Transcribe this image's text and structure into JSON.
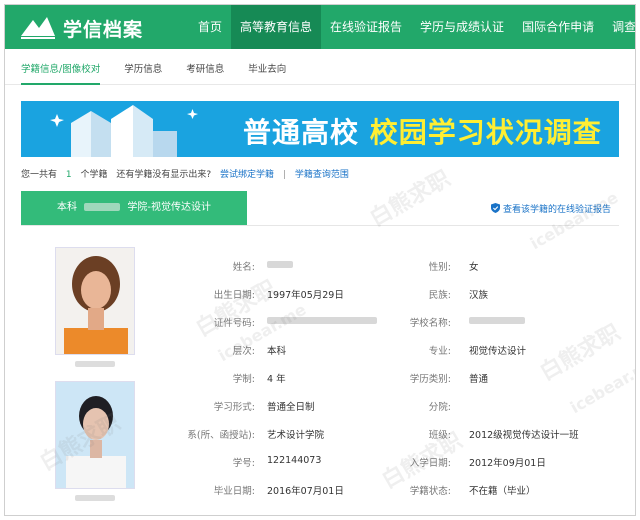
{
  "brand": {
    "title": "学信档案",
    "color": "#22a86a"
  },
  "nav": {
    "items": [
      "首页",
      "高等教育信息",
      "在线验证报告",
      "学历与成绩认证",
      "国际合作申请",
      "调查/投票"
    ],
    "active_index": 1
  },
  "subnav": {
    "items": [
      "学籍信息/图像校对",
      "学历信息",
      "考研信息",
      "毕业去向"
    ],
    "active_index": 0
  },
  "banner": {
    "part1": "普通高校",
    "part2": "校园学习状况调查"
  },
  "infoline": {
    "prefix": "您一共有",
    "count": "1",
    "suffix": "个学籍",
    "question": "还有学籍没有显示出来?",
    "link1": "尝试绑定学籍",
    "separator": "|",
    "link2": "学籍查询范围"
  },
  "record_tab": {
    "level": "本科",
    "school_suffix": "学院-视觉传达设计"
  },
  "verify_link": "查看该学籍的在线验证报告",
  "details": {
    "name_label": "姓名:",
    "gender_label": "性别:",
    "gender": "女",
    "birth_label": "出生日期:",
    "birth": "1997年05月29日",
    "ethnicity_label": "民族:",
    "ethnicity": "汉族",
    "id_label": "证件号码:",
    "school_label": "学校名称:",
    "level_label": "层次:",
    "level": "本科",
    "major_label": "专业:",
    "major": "视觉传达设计",
    "duration_label": "学制:",
    "duration": "4 年",
    "category_label": "学历类别:",
    "category": "普通",
    "form_label": "学习形式:",
    "form": "普通全日制",
    "branch_label": "分院:",
    "dept_label": "系(所、函授站):",
    "dept": "艺术设计学院",
    "class_label": "班级:",
    "class": "2012级视觉传达设计一班",
    "student_no_label": "学号:",
    "student_no": "122144073",
    "entry_label": "入学日期:",
    "entry": "2012年09月01日",
    "grad_label": "毕业日期:",
    "grad": "2016年07月01日",
    "status_label": "学籍状态:",
    "status": "不在籍（毕业）"
  },
  "watermark": {
    "cn": "白熊求职",
    "en": "icebear.me"
  }
}
